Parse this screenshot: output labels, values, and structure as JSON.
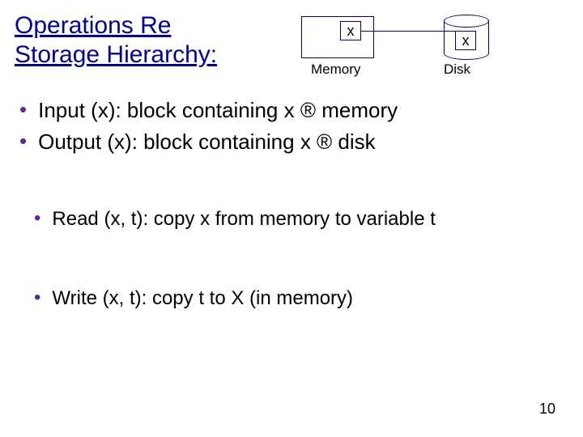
{
  "title": "Operations Re\nStorage Hierarchy:",
  "diagram": {
    "x_mem": "x",
    "x_disk": "x",
    "memory_label": "Memory",
    "disk_label": "Disk"
  },
  "bullets1": {
    "b0": "Input (x):   block containing x ® memory",
    "b1": "Output (x): block containing x ® disk"
  },
  "bullets2": {
    "b0": "Read (x, t): copy x from memory to variable t"
  },
  "bullets3": {
    "b0": "Write (x, t):  copy t  to X (in memory)"
  },
  "glyphs": {
    "bullet": "•",
    "arrow": "®"
  },
  "page_number": "10"
}
